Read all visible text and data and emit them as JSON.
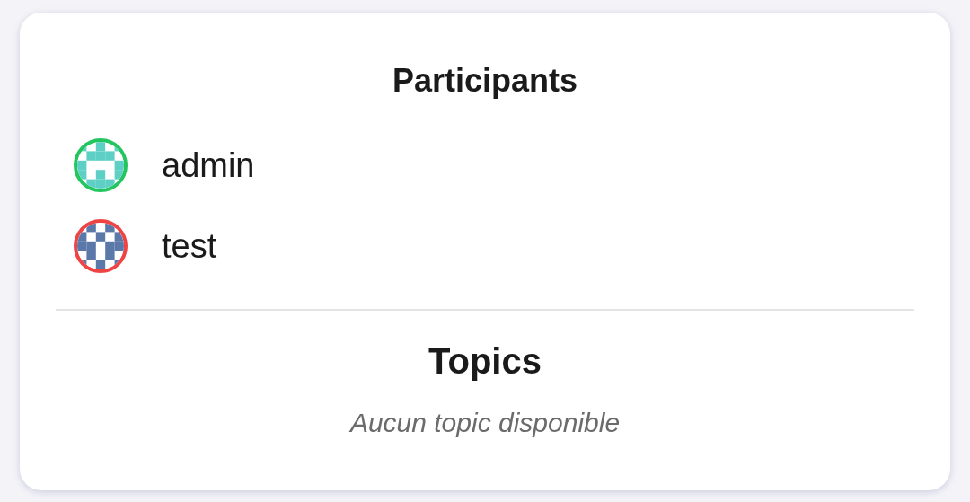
{
  "participants": {
    "title": "Participants",
    "items": [
      {
        "name": "admin",
        "color": "#22c55e"
      },
      {
        "name": "test",
        "color": "#ef4444"
      }
    ]
  },
  "topics": {
    "title": "Topics",
    "empty_message": "Aucun topic disponible"
  }
}
